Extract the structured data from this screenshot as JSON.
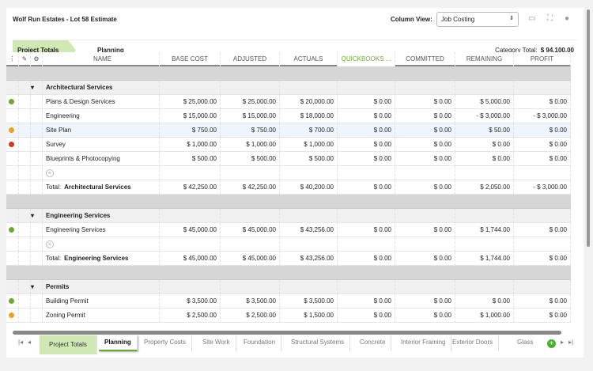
{
  "header": {
    "title": "Wolf Run Estates - Lot 58 Estimate",
    "column_view_label": "Column View:",
    "column_view_value": "Job Costing"
  },
  "breadcrumb": {
    "root": "Project Totals",
    "current": "Planning",
    "category_total_label": "Category Total:",
    "category_total": "$ 94,100.00"
  },
  "columns": [
    "NAME",
    "BASE COST",
    "ADJUSTED",
    "ACTUALS",
    "QUICKBOOKS ...",
    "COMMITTED",
    "REMAINING",
    "PROFIT"
  ],
  "colors": {
    "green": "#6aab2e",
    "orange": "#f0a020",
    "red": "#d03a1a",
    "accent": "#cfe8b4"
  },
  "groups": [
    {
      "name": "Architectural Services",
      "rows": [
        {
          "status": "green",
          "name": "Plans & Design Services",
          "values": [
            "$ 25,000.00",
            "$ 25,000.00",
            "$ 20,000.00",
            "$ 0.00",
            "$ 0.00",
            "$ 5,000.00",
            "$ 0.00"
          ]
        },
        {
          "status": "",
          "name": "Engineering",
          "values": [
            "$ 15,000.00",
            "$ 15,000.00",
            "$ 18,000.00",
            "$ 0.00",
            "$ 0.00",
            "- $ 3,000.00",
            "- $ 3,000.00"
          ]
        },
        {
          "status": "orange",
          "name": "Site Plan",
          "values": [
            "$ 750.00",
            "$ 750.00",
            "$ 700.00",
            "$ 0.00",
            "$ 0.00",
            "$ 50.00",
            "$ 0.00"
          ]
        },
        {
          "status": "red",
          "name": "Survey",
          "values": [
            "$ 1,000.00",
            "$ 1,000.00",
            "$ 1,000.00",
            "$ 0.00",
            "$ 0.00",
            "$ 0.00",
            "$ 0.00"
          ]
        },
        {
          "status": "",
          "name": "Blueprints & Photocopying",
          "values": [
            "$ 500.00",
            "$ 500.00",
            "$ 500.00",
            "$ 0.00",
            "$ 0.00",
            "$ 0.00",
            "$ 0.00"
          ]
        }
      ],
      "total": [
        "$ 42,250.00",
        "$ 42,250.00",
        "$ 40,200.00",
        "$ 0.00",
        "$ 0.00",
        "$ 2,050.00",
        "- $ 3,000.00"
      ]
    },
    {
      "name": "Engineering Services",
      "rows": [
        {
          "status": "green",
          "name": "Engineering Services",
          "values": [
            "$ 45,000.00",
            "$ 45,000.00",
            "$ 43,256.00",
            "$ 0.00",
            "$ 0.00",
            "$ 1,744.00",
            "$ 0.00"
          ]
        }
      ],
      "total": [
        "$ 45,000.00",
        "$ 45,000.00",
        "$ 43,256.00",
        "$ 0.00",
        "$ 0.00",
        "$ 1,744.00",
        "$ 0.00"
      ]
    },
    {
      "name": "Permits",
      "rows": [
        {
          "status": "green",
          "name": "Building Permit",
          "values": [
            "$ 3,500.00",
            "$ 3,500.00",
            "$ 3,500.00",
            "$ 0.00",
            "$ 0.00",
            "$ 0.00",
            "$ 0.00"
          ]
        },
        {
          "status": "orange",
          "name": "Zoning Permit",
          "values": [
            "$ 2,500.00",
            "$ 2,500.00",
            "$ 1,500.00",
            "$ 0.00",
            "$ 0.00",
            "$ 1,000.00",
            "$ 0.00"
          ]
        }
      ]
    }
  ],
  "total_prefix": "Total:",
  "tabs": [
    "Project Totals",
    "Planning",
    "Property Costs",
    "Site Work",
    "Foundation",
    "Structural Systems",
    "Concrete",
    "Interior Framing",
    "Exterior Doors",
    "Glass anc"
  ]
}
